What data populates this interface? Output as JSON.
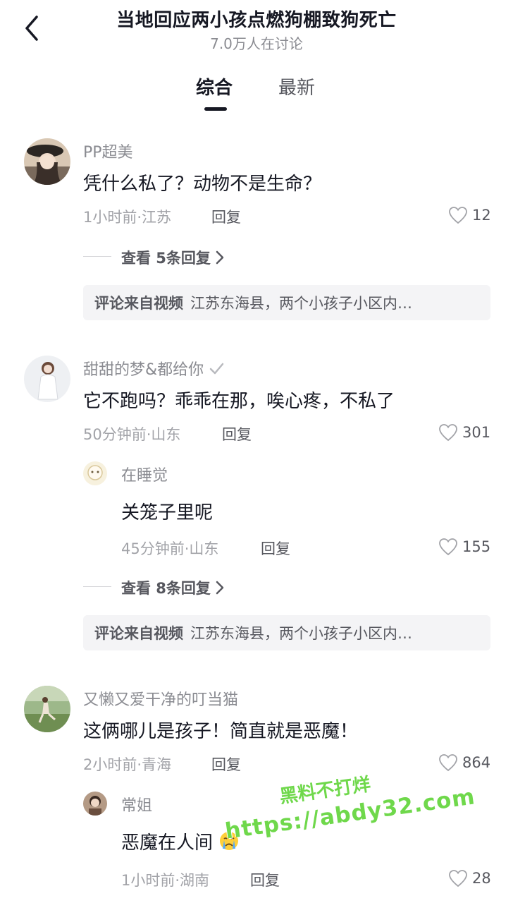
{
  "header": {
    "title": "当地回应两小孩点燃狗棚致狗死亡",
    "subtitle": "7.0万人在讨论"
  },
  "tabs": [
    {
      "label": "综合",
      "active": true
    },
    {
      "label": "最新",
      "active": false
    }
  ],
  "comments": [
    {
      "user": "PP超美",
      "text": "凭什么私了？动物不是生命？",
      "meta": "1小时前·江苏",
      "reply_label": "回复",
      "likes": "12",
      "more_replies": "查看 5条回复",
      "source_label": "评论来自视频",
      "source_text": "江苏东海县，两个小孩子小区内…"
    },
    {
      "user": "甜甜的梦&都给你",
      "text": "它不跑吗？乖乖在那，唉心疼，不私了",
      "meta": "50分钟前·山东",
      "reply_label": "回复",
      "likes": "301",
      "sub_reply": {
        "user": "在睡觉",
        "text": "关笼子里呢",
        "meta": "45分钟前·山东",
        "reply_label": "回复",
        "likes": "155"
      },
      "more_replies": "查看 8条回复",
      "source_label": "评论来自视频",
      "source_text": "江苏东海县，两个小孩子小区内…"
    },
    {
      "user": "又懒又爱干净的叮当猫",
      "text": "这俩哪儿是孩子！简直就是恶魔！",
      "meta": "2小时前·青海",
      "reply_label": "回复",
      "likes": "864",
      "sub_reply": {
        "user": "常姐",
        "text": "恶魔在人间",
        "meta": "1小时前·湖南",
        "reply_label": "回复",
        "likes": "28"
      }
    }
  ],
  "watermark": {
    "line1": "黑料不打烊",
    "line2": "https://abdy32.com"
  },
  "colors": {
    "text": "#161823",
    "secondary": "#8a8b91",
    "source_bg": "#f4f4f6",
    "watermark": "#6fd84b"
  }
}
